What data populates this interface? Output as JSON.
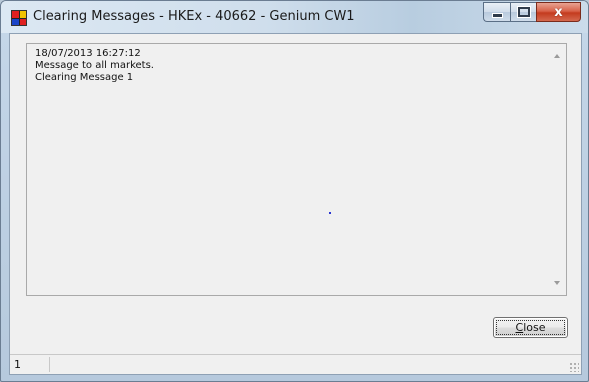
{
  "window": {
    "title": "Clearing Messages - HKEx - 40662 - Genium CW1",
    "controls": {
      "minimize_icon": "minimize-icon",
      "maximize_icon": "maximize-icon",
      "close_glyph": "x"
    }
  },
  "message": {
    "lines": [
      "18/07/2013 16:27:12",
      "Message to all markets.",
      "Clearing Message 1"
    ]
  },
  "buttons": {
    "close_mnemonic": "C",
    "close_rest": "lose"
  },
  "statusbar": {
    "pane1": "1"
  },
  "colors": {
    "close_button_red": "#c43b1f",
    "frame_blue": "#c4d6e8",
    "client_bg": "#f0f0f0"
  }
}
